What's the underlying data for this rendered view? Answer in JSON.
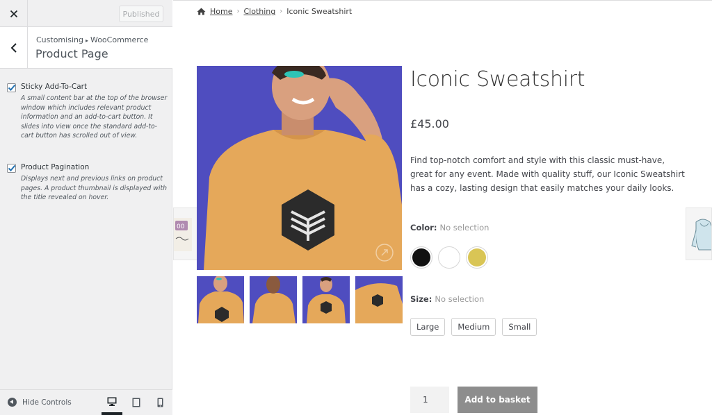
{
  "customizer": {
    "published_label": "Published",
    "breadcrumb_root": "Customising",
    "breadcrumb_parent": "WooCommerce",
    "section_title": "Product Page",
    "controls": [
      {
        "label": "Sticky Add-To-Cart",
        "checked": true,
        "description": "A small content bar at the top of the browser window which includes relevant product information and an add-to-cart button. It slides into view once the standard add-to-cart button has scrolled out of view."
      },
      {
        "label": "Product Pagination",
        "checked": true,
        "description": "Displays next and previous links on product pages. A product thumbnail is displayed with the title revealed on hover."
      }
    ],
    "footer": {
      "hide_controls_label": "Hide Controls",
      "devices": [
        "desktop-icon",
        "tablet-icon",
        "mobile-icon"
      ],
      "active_device": "desktop"
    }
  },
  "preview": {
    "breadcrumb": {
      "home": "Home",
      "category": "Clothing",
      "current": "Iconic Sweatshirt"
    },
    "product": {
      "title": "Iconic Sweatshirt",
      "price": "£45.00",
      "description": "Find top-notch comfort and style with this classic must-have, great for any event. Made with quality stuff, our Iconic Sweatshirt has a cozy, lasting design that easily matches your daily looks.",
      "color_label": "Color:",
      "color_selection": "No selection",
      "colors": [
        "#111111",
        "#ffffff",
        "#d9c555"
      ],
      "size_label": "Size:",
      "size_selection": "No selection",
      "sizes": [
        "Large",
        "Medium",
        "Small"
      ],
      "quantity": "1",
      "add_to_basket": "Add to basket"
    },
    "colors": {
      "image_background": "#4f4dbf",
      "sweatshirt": "#e5a85a",
      "button": "#8d8d8d"
    }
  }
}
